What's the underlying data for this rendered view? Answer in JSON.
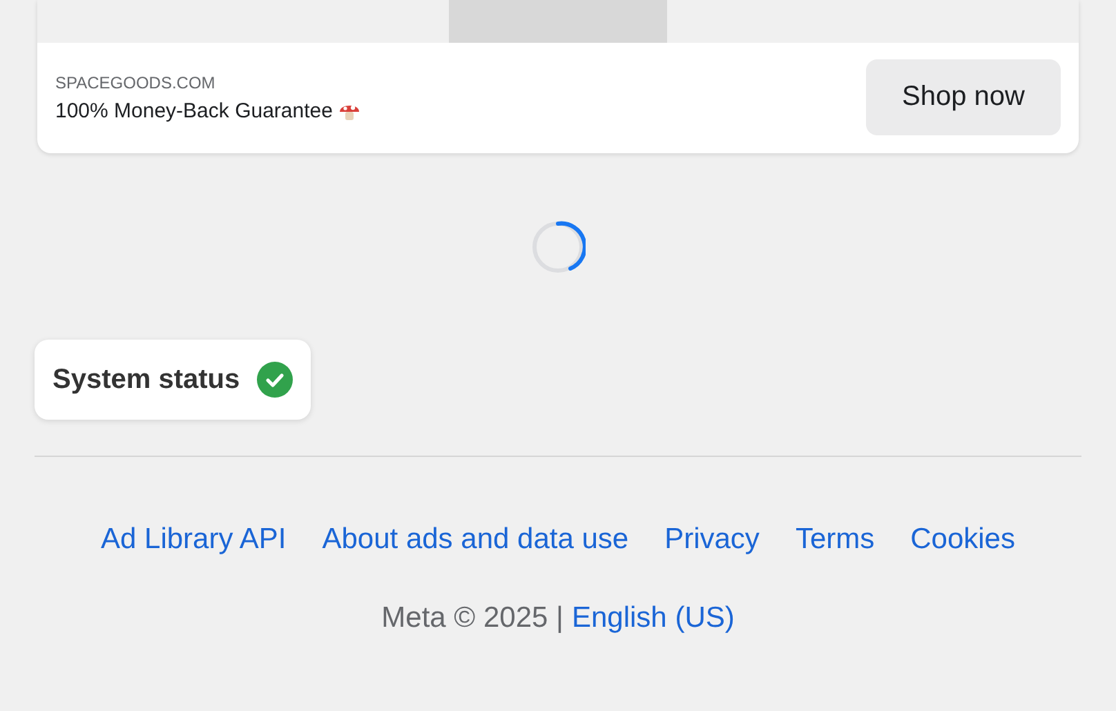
{
  "ad": {
    "domain": "SPACEGOODS.COM",
    "headline": "100% Money-Back Guarantee",
    "cta": "Shop now"
  },
  "loading": true,
  "system_status": {
    "label": "System status",
    "ok": true
  },
  "footer": {
    "links": [
      "Ad Library API",
      "About ads and data use",
      "Privacy",
      "Terms",
      "Cookies"
    ],
    "copyright": "Meta © 2025 |",
    "language": "English (US)"
  }
}
